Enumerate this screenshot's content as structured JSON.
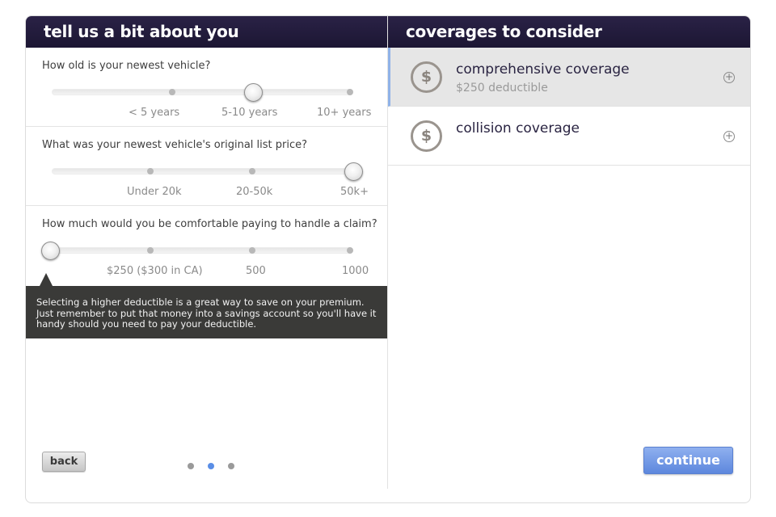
{
  "left_header": {
    "title": "tell us a bit about you"
  },
  "right_header": {
    "title": "coverages to consider"
  },
  "questions": [
    {
      "label": "How old is your newest vehicle?",
      "options": [
        "< 5 years",
        "5-10 years",
        "10+ years"
      ],
      "selected_index": 1
    },
    {
      "label": "What was your newest vehicle's original list price?",
      "options": [
        "Under 20k",
        "20-50k",
        "50k+"
      ],
      "selected_index": 3
    },
    {
      "label": "How much would you be comfortable paying to handle a claim?",
      "options": [
        "$250 ($300 in CA)",
        "500",
        "1000"
      ],
      "selected_index": 0
    }
  ],
  "tooltip": {
    "text": "Selecting a higher deductible is a great way to save on your premium. Just remember to put that money into a savings account so you'll have it handy should you need to pay your deductible."
  },
  "nav": {
    "back_label": "back",
    "continue_label": "continue",
    "page_dots": 3,
    "active_dot": 1
  },
  "coverages": [
    {
      "title": "comprehensive coverage",
      "subtitle": "$250 deductible",
      "icon": "$",
      "selected": true
    },
    {
      "title": "collision coverage",
      "subtitle": "",
      "icon": "$",
      "selected": false
    }
  ],
  "colors": {
    "header_bg": "#1c1633",
    "accent_blue": "#5d87dd",
    "tooltip_bg": "#3a3a38"
  }
}
